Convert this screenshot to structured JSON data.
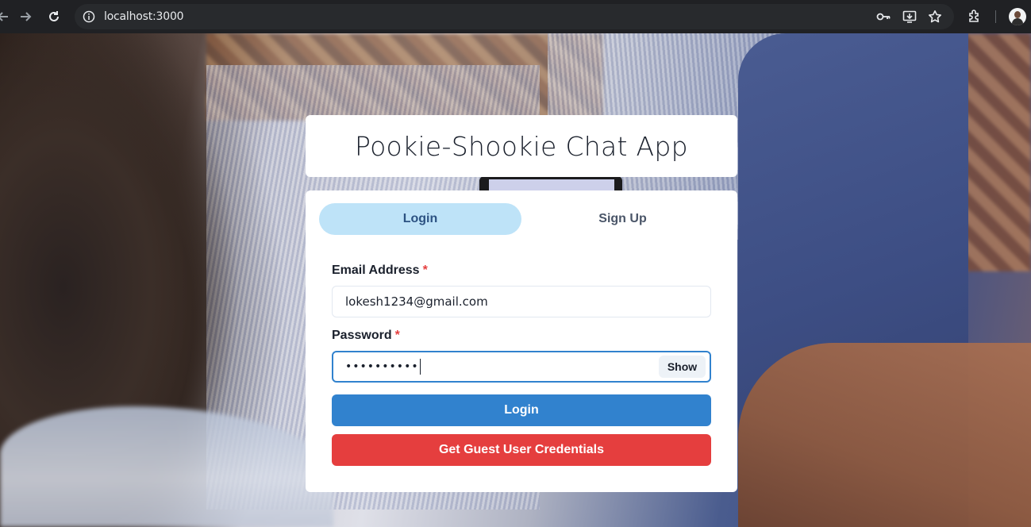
{
  "browser": {
    "url": "localhost:3000",
    "icons": [
      "back-icon",
      "forward-icon",
      "reload-icon",
      "site-info-icon",
      "password-key-icon",
      "install-app-icon",
      "bookmark-star-icon",
      "extensions-icon",
      "profile-avatar"
    ]
  },
  "app": {
    "title": "Pookie-Shookie Chat App"
  },
  "tabs": [
    {
      "label": "Login",
      "active": true
    },
    {
      "label": "Sign Up",
      "active": false
    }
  ],
  "form": {
    "email_label": "Email Address",
    "email_value": "lokesh1234@gmail.com",
    "password_label": "Password",
    "password_mask": "••••••••••",
    "required_mark": "*",
    "show_label": "Show",
    "login_button": "Login",
    "guest_button": "Get Guest User Credentials"
  },
  "colors": {
    "active_tab_bg": "#bee3f8",
    "login_button": "#3182ce",
    "guest_button": "#e53e3e",
    "focus_border": "#3182ce",
    "required": "#e53e3e"
  }
}
